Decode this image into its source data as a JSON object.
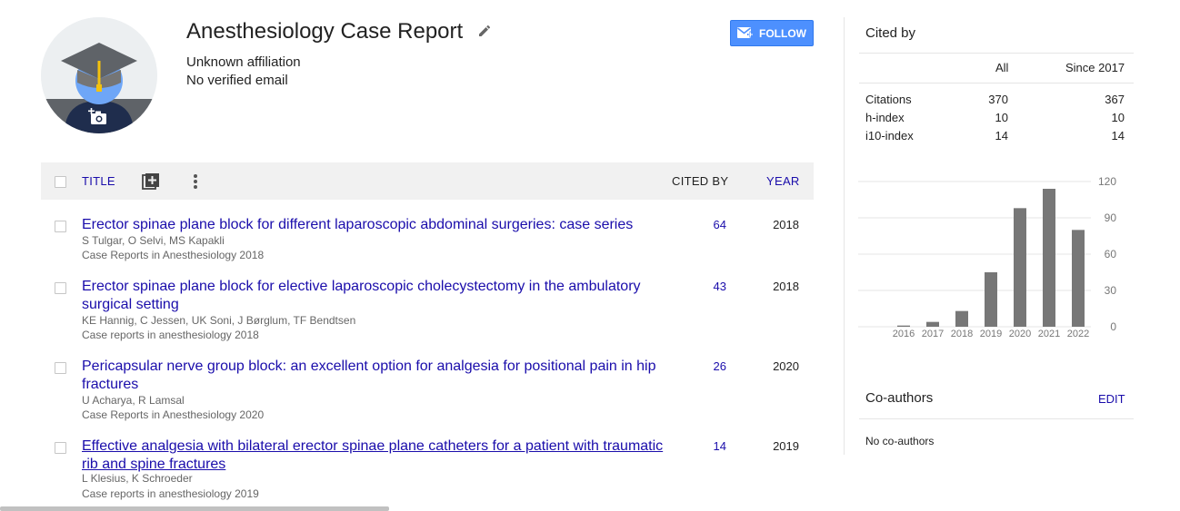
{
  "profile": {
    "name": "Anesthesiology Case Report",
    "affiliation": "Unknown affiliation",
    "email": "No verified email",
    "follow_label": "FOLLOW",
    "avatar_icon": "graduation-cap-icon",
    "camera_icon": "add-photo-icon"
  },
  "table": {
    "header": {
      "title": "TITLE",
      "cited_by": "CITED BY",
      "year": "YEAR"
    },
    "rows": [
      {
        "title": "Erector spinae plane block for different laparoscopic abdominal surgeries: case series",
        "authors": "S Tulgar, O Selvi, MS Kapakli",
        "venue": "Case Reports in Anesthesiology 2018",
        "cited": "64",
        "year": "2018"
      },
      {
        "title": "Erector spinae plane block for elective laparoscopic cholecystectomy in the ambulatory surgical setting",
        "authors": "KE Hannig, C Jessen, UK Soni, J Børglum, TF Bendtsen",
        "venue": "Case reports in anesthesiology 2018",
        "cited": "43",
        "year": "2018"
      },
      {
        "title": "Pericapsular nerve group block: an excellent option for analgesia for positional pain in hip fractures",
        "authors": "U Acharya, R Lamsal",
        "venue": "Case Reports in Anesthesiology 2020",
        "cited": "26",
        "year": "2020"
      },
      {
        "title": "Effective analgesia with bilateral erector spinae plane catheters for a patient with traumatic rib and spine fractures",
        "authors": "L Klesius, K Schroeder",
        "venue": "Case reports in anesthesiology 2019",
        "cited": "14",
        "year": "2019"
      }
    ]
  },
  "cited_by": {
    "title": "Cited by",
    "col_all": "All",
    "col_since": "Since 2017",
    "metrics": [
      {
        "label": "Citations",
        "all": "370",
        "since": "367"
      },
      {
        "label": "h-index",
        "all": "10",
        "since": "10"
      },
      {
        "label": "i10-index",
        "all": "14",
        "since": "14"
      }
    ]
  },
  "coauthors": {
    "title": "Co-authors",
    "edit_label": "EDIT",
    "empty_text": "No co-authors"
  },
  "chart_data": {
    "type": "bar",
    "categories": [
      "2016",
      "2017",
      "2018",
      "2019",
      "2020",
      "2021",
      "2022"
    ],
    "values": [
      1,
      4,
      13,
      45,
      98,
      114,
      80
    ],
    "yticks": [
      0,
      30,
      60,
      90,
      120
    ],
    "ylim": [
      0,
      120
    ],
    "grid": true,
    "bar_color": "#777777",
    "title": "",
    "xlabel": "",
    "ylabel": ""
  },
  "colors": {
    "link": "#1a0dab",
    "follow_button": "#4d90fe",
    "header_bg": "#f1f1f1"
  }
}
